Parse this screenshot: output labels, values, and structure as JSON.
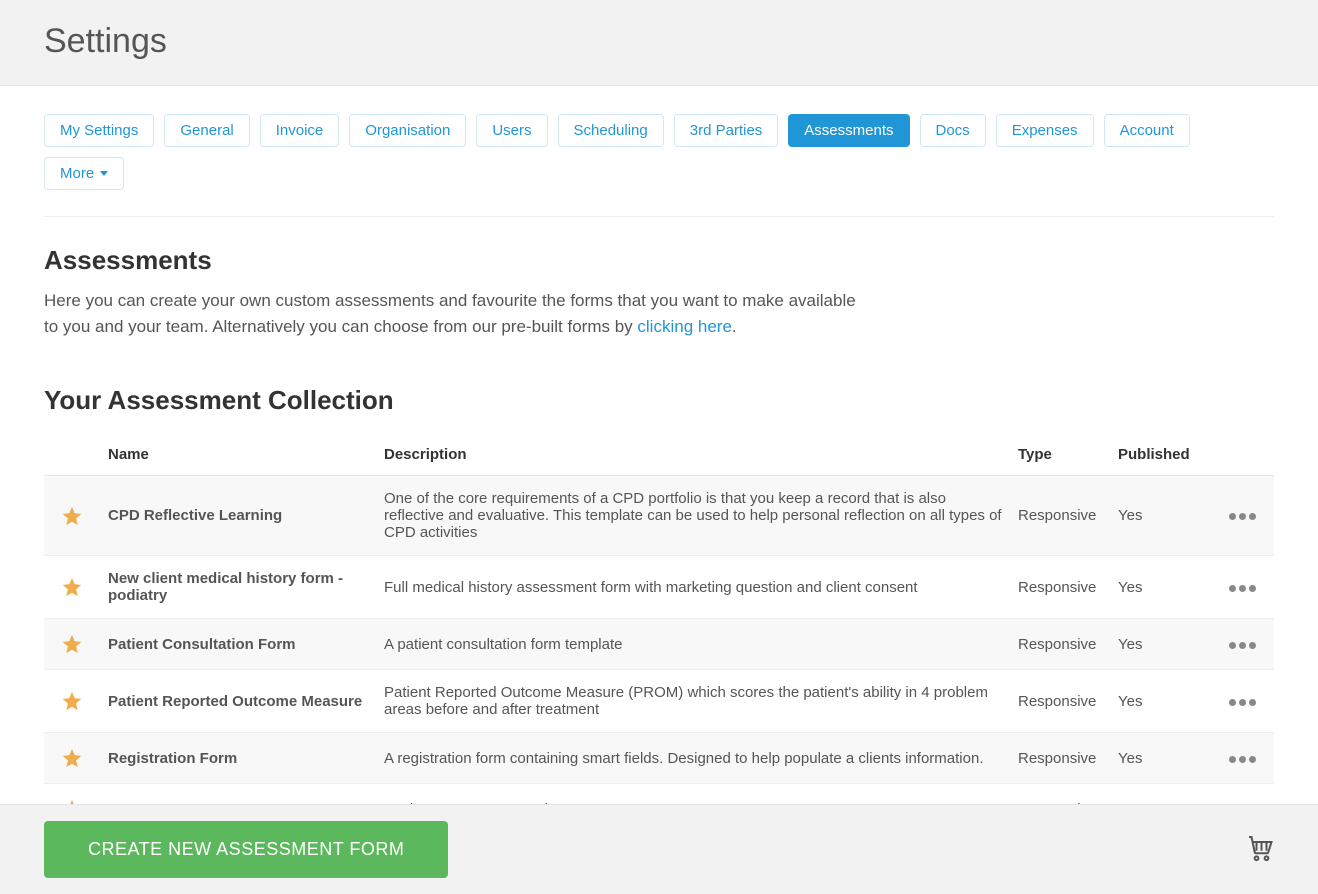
{
  "header": {
    "title": "Settings"
  },
  "tabs": [
    {
      "label": "My Settings",
      "active": false
    },
    {
      "label": "General",
      "active": false
    },
    {
      "label": "Invoice",
      "active": false
    },
    {
      "label": "Organisation",
      "active": false
    },
    {
      "label": "Users",
      "active": false
    },
    {
      "label": "Scheduling",
      "active": false
    },
    {
      "label": "3rd Parties",
      "active": false
    },
    {
      "label": "Assessments",
      "active": true
    },
    {
      "label": "Docs",
      "active": false
    },
    {
      "label": "Expenses",
      "active": false
    },
    {
      "label": "Account",
      "active": false
    },
    {
      "label": "More",
      "active": false,
      "dropdown": true
    }
  ],
  "intro": {
    "heading": "Assessments",
    "text": "Here you can create your own custom assessments and favourite the forms that you want to make available to you and your team. Alternatively you can choose from our pre-built forms by ",
    "link_text": "clicking here",
    "after_link": "."
  },
  "collection": {
    "heading": "Your Assessment Collection",
    "columns": {
      "name": "Name",
      "description": "Description",
      "type": "Type",
      "published": "Published"
    },
    "rows": [
      {
        "starred": true,
        "name": "CPD Reflective Learning",
        "description": "One of the core requirements of a CPD portfolio is that you keep a record that is also reflective and evaluative. This template can be used to help personal reflection on all types of CPD activities",
        "type": "Responsive",
        "published": "Yes"
      },
      {
        "starred": true,
        "name": "New client medical history form - podiatry",
        "description": "Full medical history assessment form with marketing question and client consent",
        "type": "Responsive",
        "published": "Yes"
      },
      {
        "starred": true,
        "name": "Patient Consultation Form",
        "description": "A patient consultation form template",
        "type": "Responsive",
        "published": "Yes"
      },
      {
        "starred": true,
        "name": "Patient Reported Outcome Measure",
        "description": "Patient Reported Outcome Measure (PROM) which scores the patient's ability in 4 problem areas before and after treatment",
        "type": "Responsive",
        "published": "Yes"
      },
      {
        "starred": true,
        "name": "Registration Form",
        "description": "A registration form containing smart fields. Designed to help populate a clients information.",
        "type": "Responsive",
        "published": "Yes"
      },
      {
        "starred": true,
        "name": "SOAP - BASICS",
        "description": "Basic SOAP notes template",
        "type": "Responsive",
        "published": "Yes"
      }
    ]
  },
  "footer": {
    "create_label": "CREATE NEW ASSESSMENT FORM"
  }
}
